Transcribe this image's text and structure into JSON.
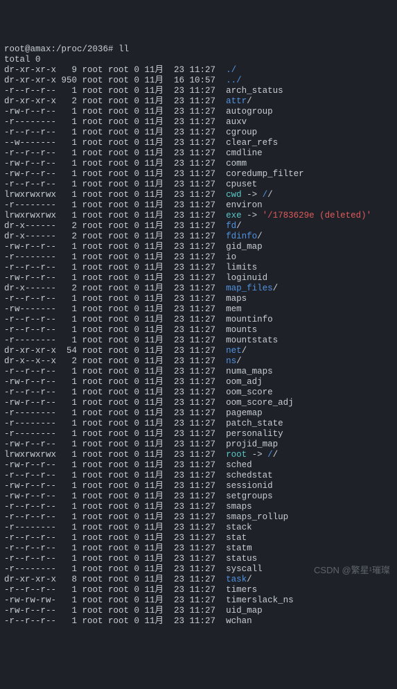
{
  "prompt": {
    "user": "root",
    "host": "amax",
    "cwd": "/proc/2036",
    "symbol": "#",
    "command": "ll"
  },
  "total_line": "total 0",
  "watermark": "CSDN @繁星¹璀璨",
  "colors": {
    "dir": "#5294e2",
    "exec": "#4fb35a",
    "link": "#5bc7c7",
    "red": "#e05a5a",
    "text": "#c8ced6",
    "bg": "#1e2228"
  },
  "entries": [
    {
      "perm": "dr-xr-xr-x",
      "links": "9",
      "owner": "root",
      "group": "root",
      "size": "0",
      "month": "11月",
      "day": "23",
      "time": "11:27",
      "name": "./",
      "type": "dir"
    },
    {
      "perm": "dr-xr-xr-x",
      "links": "950",
      "owner": "root",
      "group": "root",
      "size": "0",
      "month": "11月",
      "day": "16",
      "time": "10:57",
      "name": "../",
      "type": "dir"
    },
    {
      "perm": "-r--r--r--",
      "links": "1",
      "owner": "root",
      "group": "root",
      "size": "0",
      "month": "11月",
      "day": "23",
      "time": "11:27",
      "name": "arch_status",
      "type": "file"
    },
    {
      "perm": "dr-xr-xr-x",
      "links": "2",
      "owner": "root",
      "group": "root",
      "size": "0",
      "month": "11月",
      "day": "23",
      "time": "11:27",
      "name": "attr",
      "suffix": "/",
      "type": "dir"
    },
    {
      "perm": "-rw-r--r--",
      "links": "1",
      "owner": "root",
      "group": "root",
      "size": "0",
      "month": "11月",
      "day": "23",
      "time": "11:27",
      "name": "autogroup",
      "type": "file"
    },
    {
      "perm": "-r--------",
      "links": "1",
      "owner": "root",
      "group": "root",
      "size": "0",
      "month": "11月",
      "day": "23",
      "time": "11:27",
      "name": "auxv",
      "type": "file"
    },
    {
      "perm": "-r--r--r--",
      "links": "1",
      "owner": "root",
      "group": "root",
      "size": "0",
      "month": "11月",
      "day": "23",
      "time": "11:27",
      "name": "cgroup",
      "type": "file"
    },
    {
      "perm": "--w-------",
      "links": "1",
      "owner": "root",
      "group": "root",
      "size": "0",
      "month": "11月",
      "day": "23",
      "time": "11:27",
      "name": "clear_refs",
      "type": "file"
    },
    {
      "perm": "-r--r--r--",
      "links": "1",
      "owner": "root",
      "group": "root",
      "size": "0",
      "month": "11月",
      "day": "23",
      "time": "11:27",
      "name": "cmdline",
      "type": "file"
    },
    {
      "perm": "-rw-r--r--",
      "links": "1",
      "owner": "root",
      "group": "root",
      "size": "0",
      "month": "11月",
      "day": "23",
      "time": "11:27",
      "name": "comm",
      "type": "file"
    },
    {
      "perm": "-rw-r--r--",
      "links": "1",
      "owner": "root",
      "group": "root",
      "size": "0",
      "month": "11月",
      "day": "23",
      "time": "11:27",
      "name": "coredump_filter",
      "type": "file"
    },
    {
      "perm": "-r--r--r--",
      "links": "1",
      "owner": "root",
      "group": "root",
      "size": "0",
      "month": "11月",
      "day": "23",
      "time": "11:27",
      "name": "cpuset",
      "type": "file"
    },
    {
      "perm": "lrwxrwxrwx",
      "links": "1",
      "owner": "root",
      "group": "root",
      "size": "0",
      "month": "11月",
      "day": "23",
      "time": "11:27",
      "name": "cwd",
      "type": "link",
      "arrow": " -> ",
      "target": "/",
      "target_suffix": "/",
      "target_type": "dir"
    },
    {
      "perm": "-r--------",
      "links": "1",
      "owner": "root",
      "group": "root",
      "size": "0",
      "month": "11月",
      "day": "23",
      "time": "11:27",
      "name": "environ",
      "type": "file"
    },
    {
      "perm": "lrwxrwxrwx",
      "links": "1",
      "owner": "root",
      "group": "root",
      "size": "0",
      "month": "11月",
      "day": "23",
      "time": "11:27",
      "name": "exe",
      "type": "link",
      "arrow": " -> ",
      "target": "'/1783629e (deleted)'",
      "target_type": "red"
    },
    {
      "perm": "dr-x------",
      "links": "2",
      "owner": "root",
      "group": "root",
      "size": "0",
      "month": "11月",
      "day": "23",
      "time": "11:27",
      "name": "fd",
      "suffix": "/",
      "type": "dir"
    },
    {
      "perm": "dr-x------",
      "links": "2",
      "owner": "root",
      "group": "root",
      "size": "0",
      "month": "11月",
      "day": "23",
      "time": "11:27",
      "name": "fdinfo",
      "suffix": "/",
      "type": "dir"
    },
    {
      "perm": "-rw-r--r--",
      "links": "1",
      "owner": "root",
      "group": "root",
      "size": "0",
      "month": "11月",
      "day": "23",
      "time": "11:27",
      "name": "gid_map",
      "type": "file"
    },
    {
      "perm": "-r--------",
      "links": "1",
      "owner": "root",
      "group": "root",
      "size": "0",
      "month": "11月",
      "day": "23",
      "time": "11:27",
      "name": "io",
      "type": "file"
    },
    {
      "perm": "-r--r--r--",
      "links": "1",
      "owner": "root",
      "group": "root",
      "size": "0",
      "month": "11月",
      "day": "23",
      "time": "11:27",
      "name": "limits",
      "type": "file"
    },
    {
      "perm": "-rw-r--r--",
      "links": "1",
      "owner": "root",
      "group": "root",
      "size": "0",
      "month": "11月",
      "day": "23",
      "time": "11:27",
      "name": "loginuid",
      "type": "file"
    },
    {
      "perm": "dr-x------",
      "links": "2",
      "owner": "root",
      "group": "root",
      "size": "0",
      "month": "11月",
      "day": "23",
      "time": "11:27",
      "name": "map_files",
      "suffix": "/",
      "type": "dir"
    },
    {
      "perm": "-r--r--r--",
      "links": "1",
      "owner": "root",
      "group": "root",
      "size": "0",
      "month": "11月",
      "day": "23",
      "time": "11:27",
      "name": "maps",
      "type": "file"
    },
    {
      "perm": "-rw-------",
      "links": "1",
      "owner": "root",
      "group": "root",
      "size": "0",
      "month": "11月",
      "day": "23",
      "time": "11:27",
      "name": "mem",
      "type": "file"
    },
    {
      "perm": "-r--r--r--",
      "links": "1",
      "owner": "root",
      "group": "root",
      "size": "0",
      "month": "11月",
      "day": "23",
      "time": "11:27",
      "name": "mountinfo",
      "type": "file"
    },
    {
      "perm": "-r--r--r--",
      "links": "1",
      "owner": "root",
      "group": "root",
      "size": "0",
      "month": "11月",
      "day": "23",
      "time": "11:27",
      "name": "mounts",
      "type": "file"
    },
    {
      "perm": "-r--------",
      "links": "1",
      "owner": "root",
      "group": "root",
      "size": "0",
      "month": "11月",
      "day": "23",
      "time": "11:27",
      "name": "mountstats",
      "type": "file"
    },
    {
      "perm": "dr-xr-xr-x",
      "links": "54",
      "owner": "root",
      "group": "root",
      "size": "0",
      "month": "11月",
      "day": "23",
      "time": "11:27",
      "name": "net",
      "suffix": "/",
      "type": "dir"
    },
    {
      "perm": "dr-x--x--x",
      "links": "2",
      "owner": "root",
      "group": "root",
      "size": "0",
      "month": "11月",
      "day": "23",
      "time": "11:27",
      "name": "ns",
      "suffix": "/",
      "type": "dir"
    },
    {
      "perm": "-r--r--r--",
      "links": "1",
      "owner": "root",
      "group": "root",
      "size": "0",
      "month": "11月",
      "day": "23",
      "time": "11:27",
      "name": "numa_maps",
      "type": "file"
    },
    {
      "perm": "-rw-r--r--",
      "links": "1",
      "owner": "root",
      "group": "root",
      "size": "0",
      "month": "11月",
      "day": "23",
      "time": "11:27",
      "name": "oom_adj",
      "type": "file"
    },
    {
      "perm": "-r--r--r--",
      "links": "1",
      "owner": "root",
      "group": "root",
      "size": "0",
      "month": "11月",
      "day": "23",
      "time": "11:27",
      "name": "oom_score",
      "type": "file"
    },
    {
      "perm": "-rw-r--r--",
      "links": "1",
      "owner": "root",
      "group": "root",
      "size": "0",
      "month": "11月",
      "day": "23",
      "time": "11:27",
      "name": "oom_score_adj",
      "type": "file"
    },
    {
      "perm": "-r--------",
      "links": "1",
      "owner": "root",
      "group": "root",
      "size": "0",
      "month": "11月",
      "day": "23",
      "time": "11:27",
      "name": "pagemap",
      "type": "file"
    },
    {
      "perm": "-r--------",
      "links": "1",
      "owner": "root",
      "group": "root",
      "size": "0",
      "month": "11月",
      "day": "23",
      "time": "11:27",
      "name": "patch_state",
      "type": "file"
    },
    {
      "perm": "-r--------",
      "links": "1",
      "owner": "root",
      "group": "root",
      "size": "0",
      "month": "11月",
      "day": "23",
      "time": "11:27",
      "name": "personality",
      "type": "file"
    },
    {
      "perm": "-rw-r--r--",
      "links": "1",
      "owner": "root",
      "group": "root",
      "size": "0",
      "month": "11月",
      "day": "23",
      "time": "11:27",
      "name": "projid_map",
      "type": "file"
    },
    {
      "perm": "lrwxrwxrwx",
      "links": "1",
      "owner": "root",
      "group": "root",
      "size": "0",
      "month": "11月",
      "day": "23",
      "time": "11:27",
      "name": "root",
      "type": "link",
      "arrow": " -> ",
      "target": "/",
      "target_suffix": "/",
      "target_type": "dir"
    },
    {
      "perm": "-rw-r--r--",
      "links": "1",
      "owner": "root",
      "group": "root",
      "size": "0",
      "month": "11月",
      "day": "23",
      "time": "11:27",
      "name": "sched",
      "type": "file"
    },
    {
      "perm": "-r--r--r--",
      "links": "1",
      "owner": "root",
      "group": "root",
      "size": "0",
      "month": "11月",
      "day": "23",
      "time": "11:27",
      "name": "schedstat",
      "type": "file"
    },
    {
      "perm": "-rw-r--r--",
      "links": "1",
      "owner": "root",
      "group": "root",
      "size": "0",
      "month": "11月",
      "day": "23",
      "time": "11:27",
      "name": "sessionid",
      "type": "file"
    },
    {
      "perm": "-rw-r--r--",
      "links": "1",
      "owner": "root",
      "group": "root",
      "size": "0",
      "month": "11月",
      "day": "23",
      "time": "11:27",
      "name": "setgroups",
      "type": "file"
    },
    {
      "perm": "-r--r--r--",
      "links": "1",
      "owner": "root",
      "group": "root",
      "size": "0",
      "month": "11月",
      "day": "23",
      "time": "11:27",
      "name": "smaps",
      "type": "file"
    },
    {
      "perm": "-r--r--r--",
      "links": "1",
      "owner": "root",
      "group": "root",
      "size": "0",
      "month": "11月",
      "day": "23",
      "time": "11:27",
      "name": "smaps_rollup",
      "type": "file"
    },
    {
      "perm": "-r--------",
      "links": "1",
      "owner": "root",
      "group": "root",
      "size": "0",
      "month": "11月",
      "day": "23",
      "time": "11:27",
      "name": "stack",
      "type": "file"
    },
    {
      "perm": "-r--r--r--",
      "links": "1",
      "owner": "root",
      "group": "root",
      "size": "0",
      "month": "11月",
      "day": "23",
      "time": "11:27",
      "name": "stat",
      "type": "file"
    },
    {
      "perm": "-r--r--r--",
      "links": "1",
      "owner": "root",
      "group": "root",
      "size": "0",
      "month": "11月",
      "day": "23",
      "time": "11:27",
      "name": "statm",
      "type": "file"
    },
    {
      "perm": "-r--r--r--",
      "links": "1",
      "owner": "root",
      "group": "root",
      "size": "0",
      "month": "11月",
      "day": "23",
      "time": "11:27",
      "name": "status",
      "type": "file"
    },
    {
      "perm": "-r--------",
      "links": "1",
      "owner": "root",
      "group": "root",
      "size": "0",
      "month": "11月",
      "day": "23",
      "time": "11:27",
      "name": "syscall",
      "type": "file"
    },
    {
      "perm": "dr-xr-xr-x",
      "links": "8",
      "owner": "root",
      "group": "root",
      "size": "0",
      "month": "11月",
      "day": "23",
      "time": "11:27",
      "name": "task",
      "suffix": "/",
      "type": "dir"
    },
    {
      "perm": "-r--r--r--",
      "links": "1",
      "owner": "root",
      "group": "root",
      "size": "0",
      "month": "11月",
      "day": "23",
      "time": "11:27",
      "name": "timers",
      "type": "file"
    },
    {
      "perm": "-rw-rw-rw-",
      "links": "1",
      "owner": "root",
      "group": "root",
      "size": "0",
      "month": "11月",
      "day": "23",
      "time": "11:27",
      "name": "timerslack_ns",
      "type": "file"
    },
    {
      "perm": "-rw-r--r--",
      "links": "1",
      "owner": "root",
      "group": "root",
      "size": "0",
      "month": "11月",
      "day": "23",
      "time": "11:27",
      "name": "uid_map",
      "type": "file"
    },
    {
      "perm": "-r--r--r--",
      "links": "1",
      "owner": "root",
      "group": "root",
      "size": "0",
      "month": "11月",
      "day": "23",
      "time": "11:27",
      "name": "wchan",
      "type": "file"
    }
  ]
}
